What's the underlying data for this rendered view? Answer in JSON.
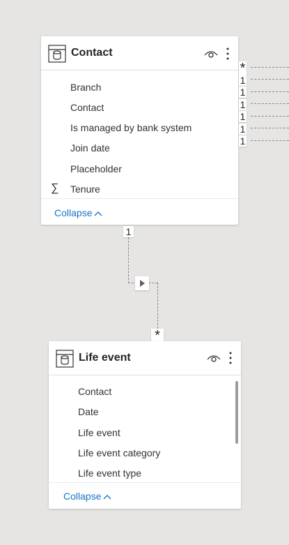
{
  "contact_table": {
    "title": "Contact",
    "icon": "table-icon",
    "fields": [
      {
        "label": "Branch"
      },
      {
        "label": "Contact"
      },
      {
        "label": "Is managed by bank system"
      },
      {
        "label": "Join date"
      },
      {
        "label": "Placeholder"
      },
      {
        "label": "Tenure",
        "icon": "sigma-icon"
      }
    ],
    "collapse_label": "Collapse",
    "right_cardinalities": [
      "*",
      "1",
      "1",
      "1",
      "1",
      "1",
      "1"
    ],
    "bottom_cardinality": "1"
  },
  "life_event_table": {
    "title": "Life event",
    "icon": "table-icon",
    "fields": [
      {
        "label": "Contact"
      },
      {
        "label": "Date"
      },
      {
        "label": "Life event"
      },
      {
        "label": "Life event category"
      },
      {
        "label": "Life event type"
      }
    ],
    "collapse_label": "Collapse",
    "top_cardinality": "*"
  },
  "relationship": {
    "direction_icon": "triangle-right-icon"
  }
}
